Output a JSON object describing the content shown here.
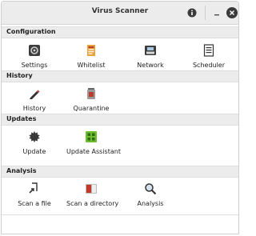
{
  "window": {
    "title": "Virus Scanner"
  },
  "sections": {
    "configuration": {
      "label": "Configuration",
      "items": [
        "Settings",
        "Whitelist",
        "Network",
        "Scheduler"
      ]
    },
    "history": {
      "label": "History",
      "items": [
        "History",
        "Quarantine"
      ]
    },
    "updates": {
      "label": "Updates",
      "items": [
        "Update",
        "Update Assistant"
      ]
    },
    "analysis": {
      "label": "Analysis",
      "items": [
        "Scan a file",
        "Scan a directory",
        "Analysis"
      ]
    }
  },
  "icons": {
    "about": "info-icon",
    "minimize": "minimize-icon",
    "close": "close-icon"
  },
  "colors": {
    "titlebar": "#ececec",
    "section_header": "#ececec",
    "close_button": "#3a3a3a",
    "update_assistant_green": "#6dbb2e",
    "whitelist_orange": "#e8a23a"
  }
}
